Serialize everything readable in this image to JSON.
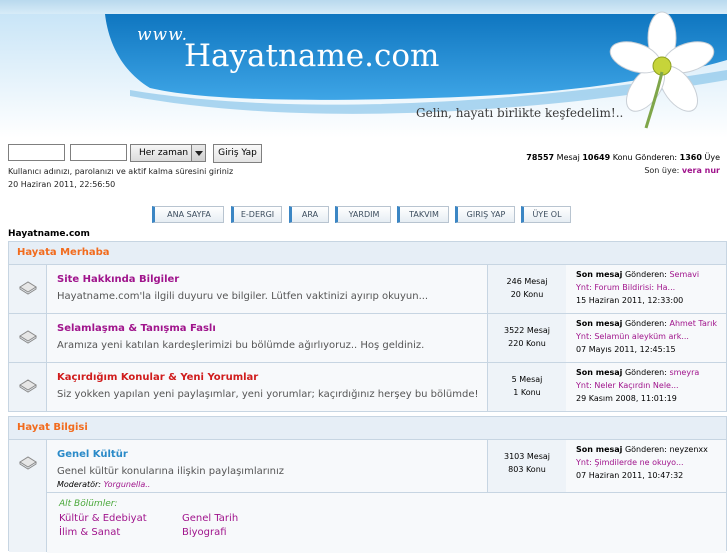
{
  "header": {
    "www": "www.",
    "brand": "Hayatname.com",
    "slogan": "Gelin, hayatı birlikte keşfedelim!.."
  },
  "login": {
    "username_value": "",
    "password_value": "",
    "period_selected": "Her zaman",
    "submit_label": "Giriş Yap",
    "hint": "Kullanıcı adınızı, parolanızı ve aktif kalma süresini giriniz",
    "server_time": "20 Haziran 2011, 22:56:50"
  },
  "stats": {
    "messages": "78557",
    "messages_label": "Mesaj",
    "topics": "10649",
    "topics_label": "Konu Gönderen:",
    "members": "1360",
    "members_label": "Üye",
    "newest_label": "Son üye:",
    "newest_name": "vera nur"
  },
  "nav": [
    {
      "label": "ANA SAYFA",
      "active": true
    },
    {
      "label": "E-DERGI",
      "active": true
    },
    {
      "label": "ARA",
      "active": false
    },
    {
      "label": "YARDIM",
      "active": false
    },
    {
      "label": "TAKVIM",
      "active": false
    },
    {
      "label": "GIRIŞ YAP",
      "active": false
    },
    {
      "label": "ÜYE OL",
      "active": false
    }
  ],
  "breadcrumb": "Hayatname.com",
  "categories": [
    {
      "title": "Hayata Merhaba",
      "forums": [
        {
          "title": "Site Hakkında Bilgiler",
          "title_color": "#a0148c",
          "desc": "Hayatname.com'la ilgili duyuru ve bilgiler. Lütfen vaktinizi ayırıp okuyun...",
          "moderator": "",
          "moderator_label": "",
          "posts": "246 Mesaj",
          "topics": "20 Konu",
          "last_label": "Son mesaj",
          "last_sender_label": "Gönderen:",
          "last_sender": "Semavi",
          "last_topic": "Ynt: Forum Bildirisi: Ha...",
          "last_time": "15 Haziran 2011, 12:33:00"
        },
        {
          "title": "Selamlaşma & Tanışma Faslı",
          "title_color": "#a0148c",
          "desc": "Aramıza yeni katılan kardeşlerimizi bu bölümde ağırlıyoruz.. Hoş geldiniz.",
          "moderator": "",
          "moderator_label": "",
          "posts": "3522 Mesaj",
          "topics": "220 Konu",
          "last_label": "Son mesaj",
          "last_sender_label": "Gönderen:",
          "last_sender": "Ahmet Tarık",
          "last_topic": "Ynt: Selamün aleyküm ark...",
          "last_time": "07 Mayıs 2011, 12:45:15"
        },
        {
          "title": "Kaçırdığım Konular & Yeni Yorumlar",
          "title_color": "#d01c1c",
          "desc": "Siz yokken yapılan yeni paylaşımlar, yeni yorumlar; kaçırdığınız herşey bu bölümde!",
          "moderator": "",
          "moderator_label": "",
          "posts": "5 Mesaj",
          "topics": "1 Konu",
          "last_label": "Son mesaj",
          "last_sender_label": "Gönderen:",
          "last_sender": "smeyra",
          "last_topic": "Ynt: Neler Kaçırdın Nele...",
          "last_time": "29 Kasım 2008, 11:01:19"
        }
      ]
    },
    {
      "title": "Hayat Bilgisi",
      "forums": [
        {
          "title": "Genel Kültür",
          "title_color": "#2a8ac8",
          "desc": "Genel kültür konularına ilişkin paylaşımlarınız",
          "moderator_label": "Moderatör:",
          "moderator": "Yorgunella..",
          "posts": "3103 Mesaj",
          "topics": "803 Konu",
          "last_label": "Son mesaj",
          "last_sender_label": "Gönderen:",
          "last_sender": "neyzenxx",
          "last_topic": "Ynt: Şimdilerde ne okuyo...",
          "last_time": "07 Haziran 2011, 10:47:32"
        }
      ],
      "subboards_label": "Alt Bölümler:",
      "subboards": [
        "Kültür & Edebiyat",
        "Genel Tarih",
        "İlim & Sanat",
        "Biyografi"
      ]
    }
  ],
  "colors": {
    "accent_orange": "#f26b1d",
    "link_purple": "#a0148c",
    "nav_accent": "#3b86c4",
    "header_blue": "#1f89cf"
  },
  "icons": [
    "flower-logo-icon",
    "board-icon"
  ]
}
